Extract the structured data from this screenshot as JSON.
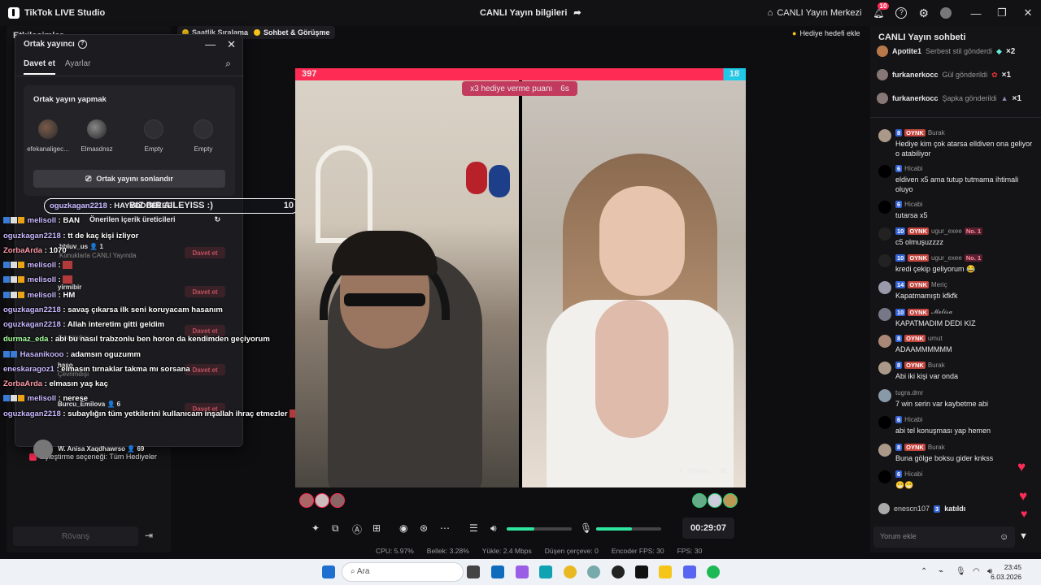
{
  "titlebar": {
    "app_name": "TikTok LIVE Studio",
    "center_title": "CANLI Yayın bilgileri",
    "live_center": "CANLI Yayın Merkezi",
    "notif_count": "10",
    "minimize": "—",
    "maximize": "❐",
    "close": "✕"
  },
  "left_panel": {
    "header": "Etkileşimler",
    "pill1": "Saatlik Sıralama",
    "pill2": "Sohbet & Görüşme",
    "match_option": "Eşleştirme seçeneği: Tüm Hediyeler",
    "rematch": "Rövanş"
  },
  "popup": {
    "title": "Ortak yayıncı",
    "tab_invite": "Davet et",
    "tab_settings": "Ayarlar",
    "cohost_header": "Ortak yayın yapmak",
    "slots": [
      {
        "name": "efekanaligec..."
      },
      {
        "name": "Elmasdnsz"
      },
      {
        "name": "Empty"
      },
      {
        "name": "Empty"
      }
    ],
    "end_button": "Ortak yayını sonlandır",
    "recommended": "Önerilen içerik üreticileri",
    "creators": [
      {
        "name": "bbluv_us",
        "count": "1",
        "sub": "Konuklarla CANLI Yayında"
      },
      {
        "name": "yirmibir",
        "sub": "Çevrimdışı"
      },
      {
        "name": "",
        "sub": "Çevrimdışı"
      },
      {
        "name": "haso",
        "sub": "Çevrimdışı"
      },
      {
        "name": "Burcu_Emilova",
        "count": "6",
        "sub": ""
      },
      {
        "name": "W. Anisa Xaqdhawrso",
        "count": "69",
        "sub": ""
      }
    ],
    "invite_label": "Davet et"
  },
  "overlay_chat": {
    "highlight_user": "oguzkagan2218",
    "highlight_pre": "HAYYDDDEEEE",
    "highlight_text": "BIZ BIR AILEYISS :)",
    "highlight_count": "10",
    "lines": [
      {
        "user": "melisoll",
        "text": ": BAN"
      },
      {
        "user": "oguzkagan2218",
        "text": ": tt de kaç kişi izliyor"
      },
      {
        "user": "ZorbaArda",
        "text": ": 1070"
      },
      {
        "user": "melisoll",
        "text": ":"
      },
      {
        "user": "melisoll",
        "text": ":"
      },
      {
        "user": "melisoll",
        "text": ": HM"
      },
      {
        "user": "oguzkagan2218",
        "text": ": savaş çıkarsa ilk seni koruyacam hasanım"
      },
      {
        "user": "oguzkagan2218",
        "text": ": Allah interetim gitti geldim"
      },
      {
        "user": "durmaz_eda",
        "text": ": abi bu nasıl trabzonlu ben horon da kendimden geçiyorum"
      },
      {
        "user": "Hasanikooo",
        "text": ": adamsın oguzumm"
      },
      {
        "user": "eneskaragoz1",
        "text": ": elmasın tırnaklar takma mı sorsana"
      },
      {
        "user": "ZorbaArda",
        "text": ": elmasın yaş kaç"
      },
      {
        "user": "melisoll",
        "text": ": nerese"
      },
      {
        "user": "oguzkagan2218",
        "text": ": subaylığın tüm yetkilerini kullanıcam inşallah ihraç etmezler"
      }
    ]
  },
  "stage": {
    "gift_goal": "Hediye hedefi ekle",
    "score_left": "397",
    "score_right": "18",
    "boost": "x3 hediye verme puanı",
    "boost_time": "6s",
    "right_name": "Elmas..."
  },
  "controls": {
    "timer": "00:29:07",
    "mic_level": 0.55,
    "speaker_level": 0.42
  },
  "stats": {
    "cpu": "CPU: 5.97%",
    "memory": "Bellek: 3.28%",
    "upload": "Yükle: 2.4 Mbps",
    "dropped": "Düşen çerçeve: 0",
    "encoder_fps": "Encoder FPS: 30",
    "fps": "FPS: 30"
  },
  "chat": {
    "header": "CANLI Yayın sohbeti",
    "gifts": [
      {
        "user": "Apotite1",
        "action": "Serbest stil gönderdi",
        "mult": "×2"
      },
      {
        "user": "furkanerkocc",
        "action": "Gül gönderildi",
        "mult": "×1"
      },
      {
        "user": "furkanerkocc",
        "action": "Şapka gönderildi",
        "mult": "×1"
      }
    ],
    "messages": [
      {
        "lvl": "8",
        "fan": "OYNK",
        "user": "Burak",
        "no1": "",
        "body": "Hediye kim çok atarsa elldiven ona geliyor o atabiliyor"
      },
      {
        "lvl": "6",
        "fan": "",
        "user": "Hicabi",
        "no1": "",
        "body": "eldiven x5 ama tutup tutmama ihtimali oluyo"
      },
      {
        "lvl": "6",
        "fan": "",
        "user": "Hicabi",
        "no1": "",
        "body": "tutarsa x5"
      },
      {
        "lvl": "10",
        "fan": "OYNK",
        "user": "ugur_exee",
        "no1": "No. 1",
        "body": "c5 olmuşuzzzz"
      },
      {
        "lvl": "10",
        "fan": "OYNK",
        "user": "ugur_exee",
        "no1": "No. 1",
        "body": "kredi çekip geliyorum 😂"
      },
      {
        "lvl": "14",
        "fan": "OYNK",
        "user": "Meriç",
        "no1": "",
        "body": "Kapatmamıştı kfkfk"
      },
      {
        "lvl": "10",
        "fan": "OYNK",
        "user": "𝓜𝓮𝓵𝓲𝓼𝓪",
        "no1": "",
        "body": "KAPATMADIM DEDI KIZ"
      },
      {
        "lvl": "8",
        "fan": "OYNK",
        "user": "umut",
        "no1": "",
        "body": "ADAAMMMMMM"
      },
      {
        "lvl": "8",
        "fan": "OYNK",
        "user": "Burak",
        "no1": "",
        "body": "Abi iki kişi var onda"
      },
      {
        "lvl": "",
        "fan": "",
        "user": "tugra.dmr",
        "no1": "",
        "body": "7 win serin var kaybetme abi"
      },
      {
        "lvl": "6",
        "fan": "",
        "user": "Hicabi",
        "no1": "",
        "body": "abi tel konuşması yap hemen"
      },
      {
        "lvl": "8",
        "fan": "OYNK",
        "user": "Burak",
        "no1": "",
        "body": "Buna gölge boksu gider knkss"
      },
      {
        "lvl": "6",
        "fan": "",
        "user": "Hicabi",
        "no1": "",
        "body": "😁😁"
      }
    ],
    "join_user": "enescn107",
    "join_lvl": "3",
    "join_text": "katıldı",
    "comment_placeholder": "Yorum ekle"
  },
  "taskbar": {
    "search": "Ara",
    "time": "23:45",
    "date": "6.03.2026"
  }
}
